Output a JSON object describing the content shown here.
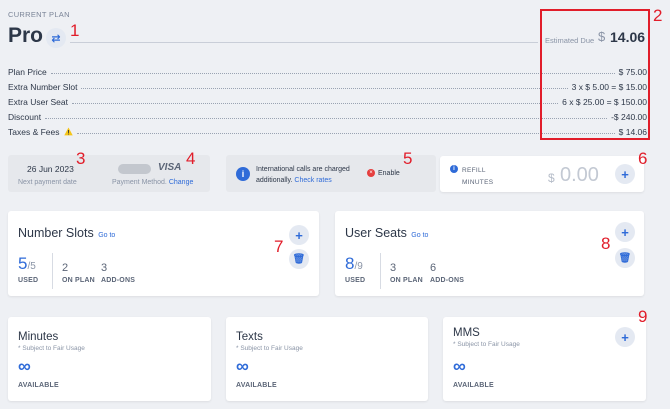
{
  "plan": {
    "section_label": "CURRENT PLAN",
    "name": "Pro",
    "estimated_due_label": "Estimated Due",
    "currency": "$",
    "estimated_due_value": "14.06"
  },
  "lines": [
    {
      "label": "Plan Price",
      "value": "$ 75.00",
      "warn": false
    },
    {
      "label": "Extra Number Slot",
      "value": "3 x $ 5.00 = $ 15.00",
      "warn": false
    },
    {
      "label": "Extra User Seat",
      "value": "6 x $ 25.00 = $ 150.00",
      "warn": false
    },
    {
      "label": "Discount",
      "value": "-$ 240.00",
      "warn": false
    },
    {
      "label": "Taxes & Fees",
      "value": "$ 14.06",
      "warn": true
    }
  ],
  "payment": {
    "next_date": "26 Jun 2023",
    "next_date_label": "Next payment date",
    "card_brand": "VISA",
    "method_label": "Payment Method.",
    "change_link": "Change"
  },
  "international": {
    "text_line1": "International calls are charged",
    "text_line2": "additionally.",
    "check_rates": "Check rates",
    "enable": "Enable"
  },
  "refill": {
    "label_line1": "REFILL",
    "label_line2": "MINUTES",
    "currency": "$",
    "amount": "0.00"
  },
  "number_slots": {
    "title": "Number Slots",
    "goto": "Go to",
    "used": "5",
    "total": "/5",
    "used_label": "USED",
    "on_plan": "2",
    "on_plan_label": "ON PLAN",
    "add_ons": "3",
    "add_ons_label": "ADD-ONS"
  },
  "user_seats": {
    "title": "User Seats",
    "goto": "Go to",
    "used": "8",
    "total": "/9",
    "used_label": "USED",
    "on_plan": "3",
    "on_plan_label": "ON PLAN",
    "add_ons": "6",
    "add_ons_label": "ADD-ONS"
  },
  "usage": [
    {
      "title": "Minutes",
      "note": "* Subject to Fair Usage",
      "status": "AVAILABLE"
    },
    {
      "title": "Texts",
      "note": "* Subject to Fair Usage",
      "status": "AVAILABLE"
    },
    {
      "title": "MMS",
      "note": "* Subject to Fair Usage",
      "status": "AVAILABLE"
    }
  ],
  "annotations": [
    "1",
    "2",
    "3",
    "4",
    "5",
    "6",
    "7",
    "8",
    "9"
  ],
  "colors": {
    "accent": "#2f6bd8",
    "annotation": "#e11d2a",
    "danger": "#e53e3e",
    "background": "#eef0f4"
  }
}
